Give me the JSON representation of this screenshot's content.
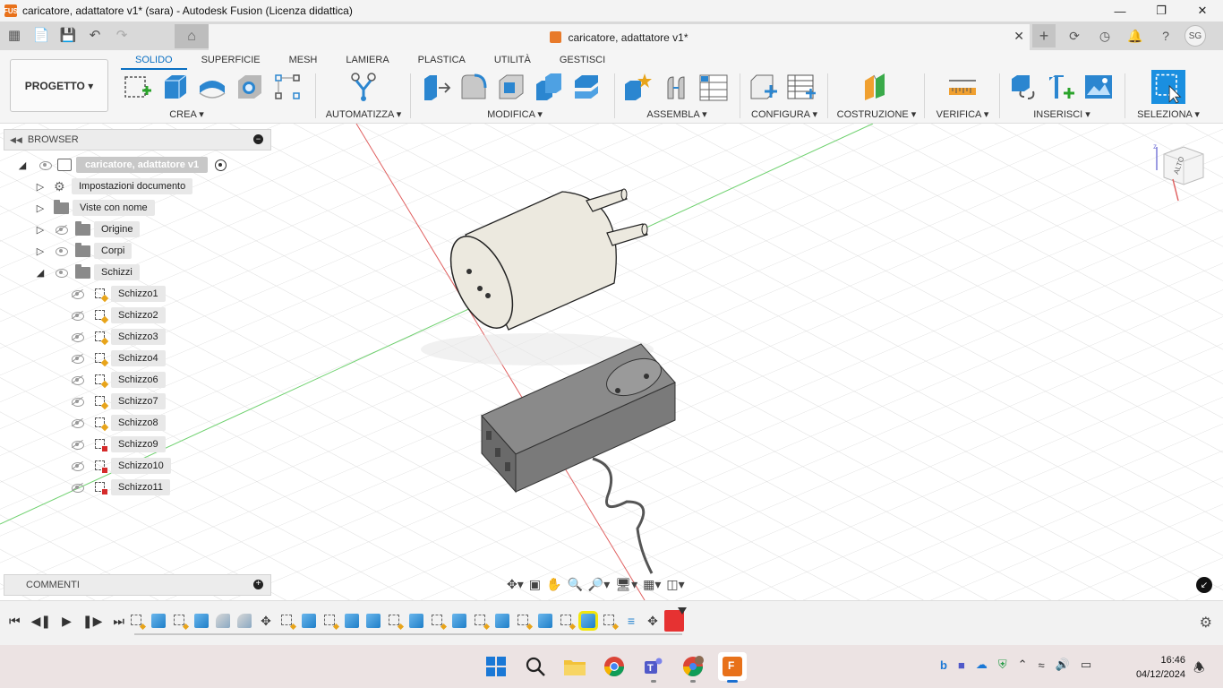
{
  "window": {
    "title": "caricatore, adattatore v1* (sara) - Autodesk Fusion (Licenza didattica)",
    "app_icon_text": "FUS"
  },
  "tabbar": {
    "document_tab": "caricatore, adattatore v1*",
    "user_initials": "SG"
  },
  "toolbar": {
    "project_button": "PROGETTO ▾",
    "tabs": [
      "SOLIDO",
      "SUPERFICIE",
      "MESH",
      "LAMIERA",
      "PLASTICA",
      "UTILITÀ",
      "GESTISCI"
    ],
    "active_tab": "SOLIDO",
    "groups": {
      "crea": "CREA ▾",
      "automatizza": "AUTOMATIZZA ▾",
      "modifica": "MODIFICA ▾",
      "assembla": "ASSEMBLA ▾",
      "configura": "CONFIGURA ▾",
      "costruzione": "COSTRUZIONE ▾",
      "verifica": "VERIFICA ▾",
      "inserisci": "INSERISCI ▾",
      "seleziona": "SELEZIONA ▾"
    }
  },
  "browser": {
    "header": "BROWSER",
    "root": "caricatore, adattatore v1",
    "items": [
      {
        "label": "Impostazioni documento",
        "icon": "gear-icon",
        "expanded": false
      },
      {
        "label": "Viste con nome",
        "icon": "folder-icon",
        "expanded": false
      },
      {
        "label": "Origine",
        "icon": "folder-icon",
        "expanded": false,
        "visibility": "hidden"
      },
      {
        "label": "Corpi",
        "icon": "folder-icon",
        "expanded": false,
        "visibility": "visible"
      },
      {
        "label": "Schizzi",
        "icon": "folder-icon",
        "expanded": true,
        "visibility": "visible"
      }
    ],
    "sketches": [
      {
        "label": "Schizzo1",
        "status": "ok"
      },
      {
        "label": "Schizzo2",
        "status": "ok"
      },
      {
        "label": "Schizzo3",
        "status": "ok"
      },
      {
        "label": "Schizzo4",
        "status": "ok"
      },
      {
        "label": "Schizzo6",
        "status": "ok"
      },
      {
        "label": "Schizzo7",
        "status": "ok"
      },
      {
        "label": "Schizzo8",
        "status": "ok"
      },
      {
        "label": "Schizzo9",
        "status": "error"
      },
      {
        "label": "Schizzo10",
        "status": "error"
      },
      {
        "label": "Schizzo11",
        "status": "error"
      }
    ]
  },
  "comments": {
    "header": "COMMENTI"
  },
  "viewcube": {
    "face_label": "ALTO"
  },
  "timeline": {
    "features": [
      "sketch",
      "body",
      "sketch",
      "body",
      "revolve",
      "revolve",
      "move",
      "sketch",
      "body",
      "sketch",
      "body",
      "body",
      "body",
      "sketch",
      "body",
      "sketch",
      "body",
      "sketch",
      "body",
      "sketch",
      "body",
      "sketch",
      "body",
      "sketch",
      "pattern",
      "move",
      "marker"
    ],
    "highlighted_index": 21
  },
  "taskbar": {
    "time": "16:46",
    "date": "04/12/2024",
    "colors": {
      "accent": "#1a6fd1",
      "fusion": "#e8711a"
    }
  }
}
